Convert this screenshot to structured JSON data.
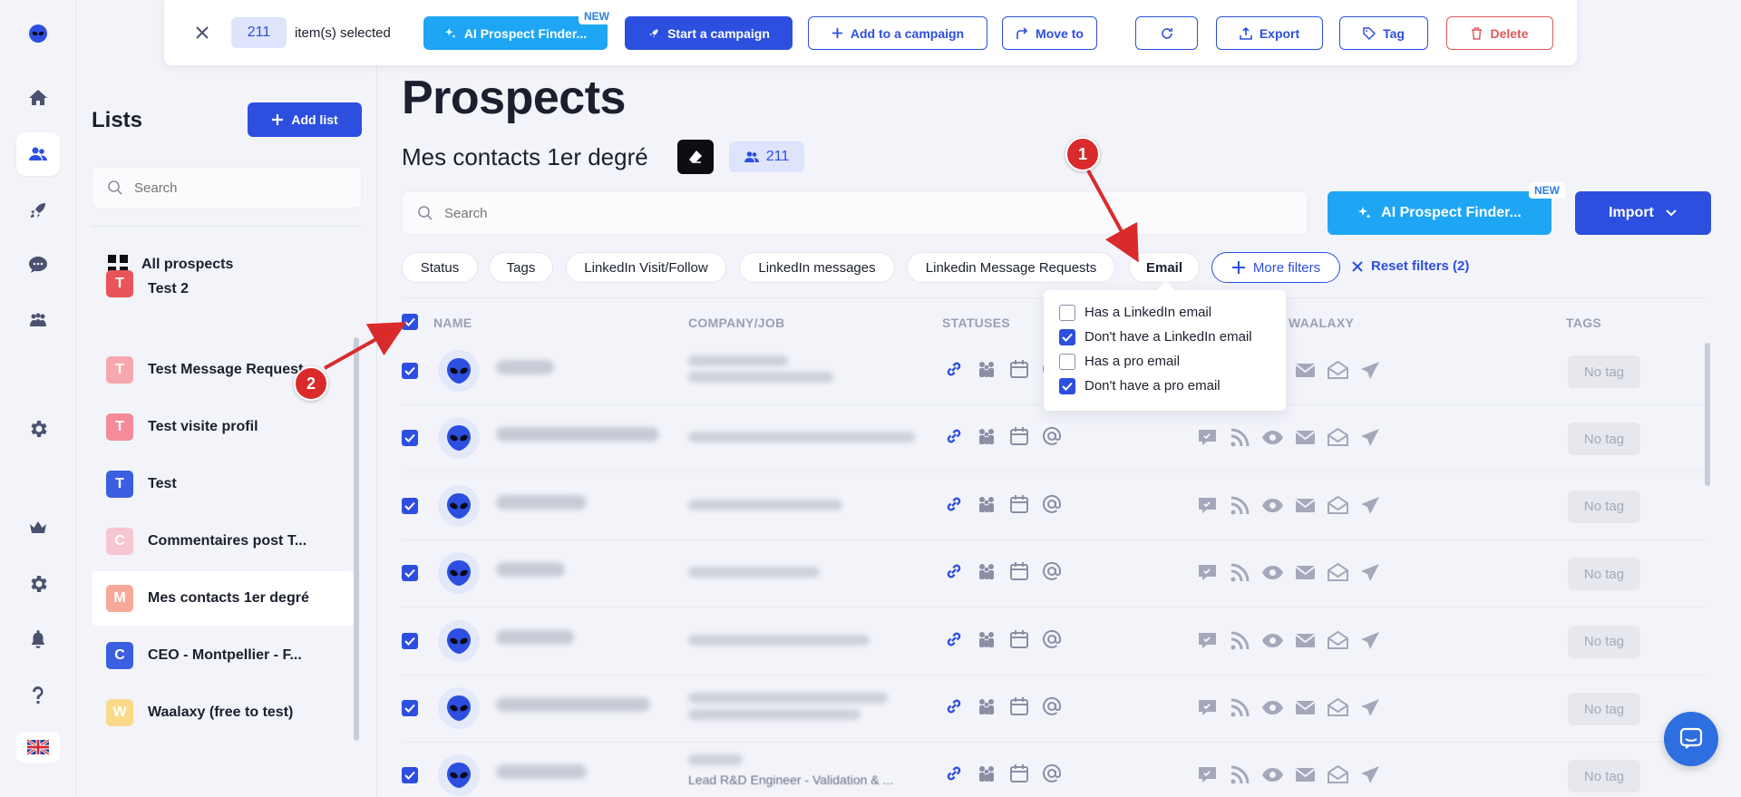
{
  "toolbar": {
    "selected_count": "211",
    "selected_text": "item(s) selected",
    "ai_finder": "AI Prospect Finder...",
    "new_badge": "NEW",
    "start_campaign": "Start a campaign",
    "add_to_campaign": "Add to a campaign",
    "move_to": "Move to",
    "export": "Export",
    "tag": "Tag",
    "delete": "Delete"
  },
  "lists": {
    "title": "Lists",
    "add_list": "Add list",
    "search_placeholder": "Search",
    "all_prospects": "All prospects",
    "items": [
      {
        "letter": "T",
        "label": "Test 2",
        "color": "#e8545a"
      },
      {
        "letter": "T",
        "label": "Test Message Request",
        "color": "#f7a7ae"
      },
      {
        "letter": "T",
        "label": "Test visite profil",
        "color": "#f58a99"
      },
      {
        "letter": "T",
        "label": "Test",
        "color": "#3b5fe0"
      },
      {
        "letter": "C",
        "label": "Commentaires post T...",
        "color": "#f8c6d2"
      },
      {
        "letter": "M",
        "label": "Mes contacts 1er degré",
        "color": "#f7a898"
      },
      {
        "letter": "C",
        "label": "CEO - Montpellier - F...",
        "color": "#3b5fe0"
      },
      {
        "letter": "W",
        "label": "Waalaxy (free to test)",
        "color": "#fbd98a"
      }
    ]
  },
  "main": {
    "title": "Prospects",
    "list_name": "Mes contacts 1er degré",
    "count": "211",
    "search_placeholder": "Search",
    "ai_finder": "AI Prospect Finder...",
    "new_badge": "NEW",
    "import": "Import",
    "filters": [
      "Status",
      "Tags",
      "LinkedIn Visit/Follow",
      "LinkedIn messages",
      "Linkedin Message Requests",
      "Email"
    ],
    "more_filters": "More filters",
    "reset_filters": "Reset filters (2)"
  },
  "email_dropdown": {
    "options": [
      {
        "label": "Has a LinkedIn email",
        "checked": false
      },
      {
        "label": "Don't have a LinkedIn email",
        "checked": true
      },
      {
        "label": "Has a pro email",
        "checked": false
      },
      {
        "label": "Don't have a pro email",
        "checked": true
      }
    ]
  },
  "table": {
    "columns": {
      "name": "NAME",
      "company": "COMPANY/JOB",
      "statuses": "STATUSES",
      "waalaxy": "WAALAXY",
      "tags": "TAGS"
    },
    "no_tag": "No tag",
    "visible_job_text": "Lead R&D Engineer - Validation & ..."
  },
  "annotations": {
    "marker_1": "1",
    "marker_2": "2"
  },
  "language": "EN",
  "colors": {
    "primary": "#2d4fe0",
    "ai": "#1ea6f5",
    "danger": "#e05a5a",
    "annotation": "#d92b2b"
  }
}
